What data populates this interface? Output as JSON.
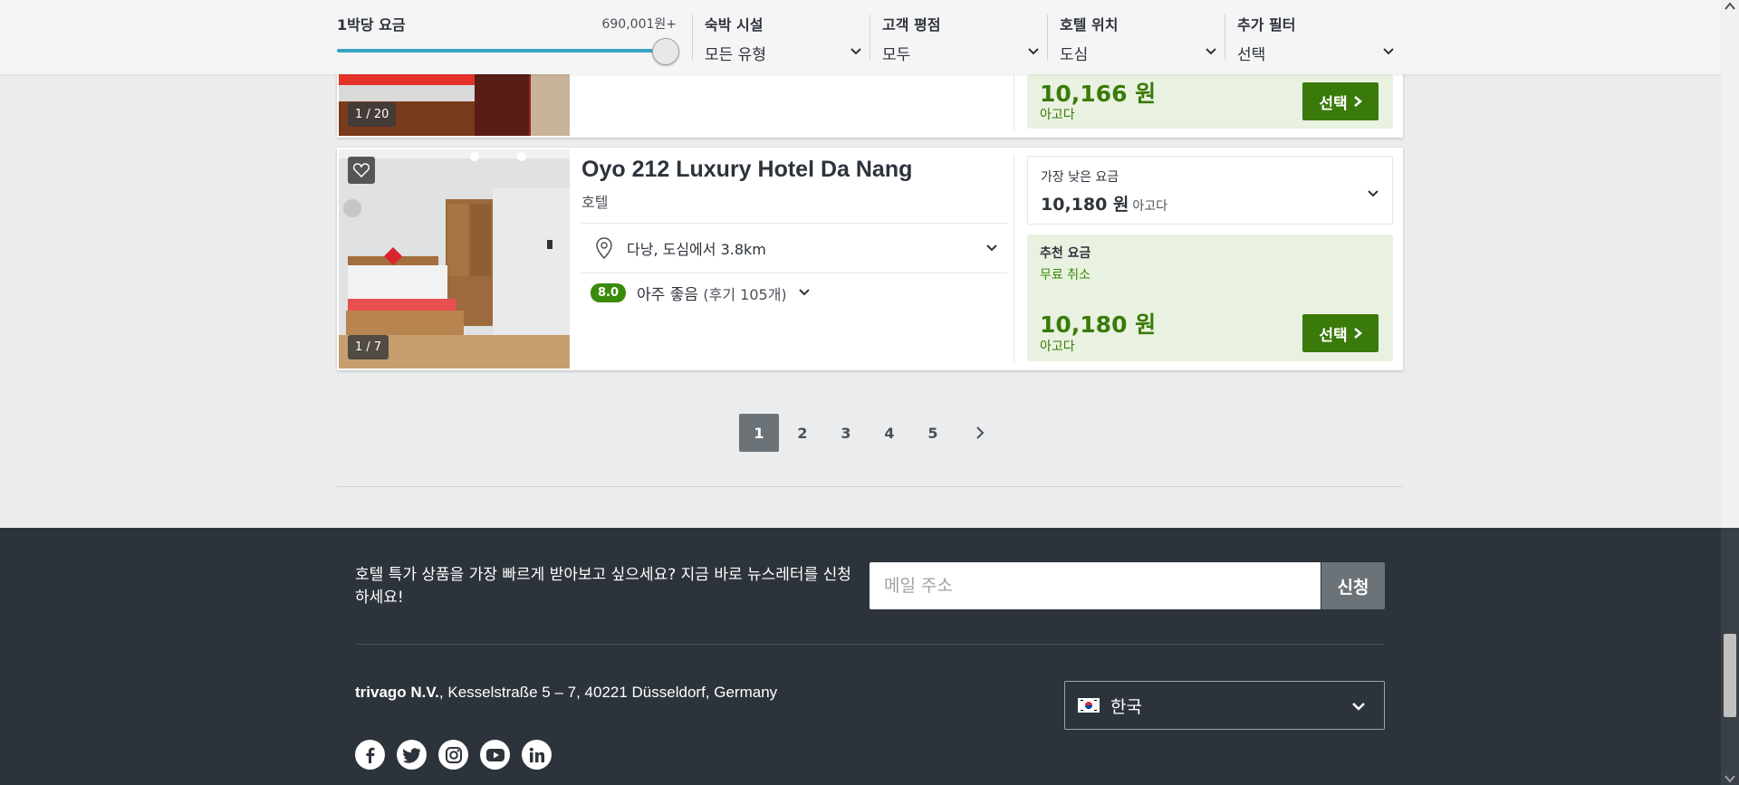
{
  "filters": {
    "price_label": "1박당 요금",
    "price_max": "690,001원+",
    "price_level": 1.0,
    "lodging_label": "숙박 시설",
    "lodging_value": "모든 유형",
    "rating_label": "고객 평점",
    "rating_value": "모두",
    "location_label": "호텔 위치",
    "location_value": "도심",
    "more_label": "추가 필터",
    "more_value": "선택"
  },
  "prev_card": {
    "photo_counter": "1 / 20",
    "price": "10,166 원",
    "source": "아고다",
    "select_label": "선택"
  },
  "hotel": {
    "name": "Oyo 212 Luxury Hotel Da Nang",
    "type": "호텔",
    "location": "다낭, 도심에서 3.8km",
    "rating_score": "8.0",
    "rating_text": "아주 좋음",
    "review_count": "(후기 105개)",
    "photo_counter": "1 / 7",
    "lowest_label": "가장 낮은 요금",
    "lowest_price": "10,180 원",
    "lowest_source": "아고다",
    "recommended_label": "추천 요금",
    "free_cancel": "무료 취소",
    "rec_price": "10,180 원",
    "rec_source": "아고다",
    "select_label": "선택"
  },
  "pagination": {
    "pages": [
      "1",
      "2",
      "3",
      "4",
      "5"
    ],
    "active": "1"
  },
  "footer": {
    "newsletter_text": "호텔 특가 상품을 가장 빠르게 받아보고 싶으세요? 지금 바로 뉴스레터를 신청하세요!",
    "email_placeholder": "메일 주소",
    "subscribe_label": "신청",
    "company_name": "trivago N.V.",
    "company_address": ", Kesselstraße 5 – 7, 40221 Düsseldorf, Germany",
    "language": "한국",
    "social": [
      "facebook-icon",
      "twitter-icon",
      "instagram-icon",
      "youtube-icon",
      "linkedin-icon"
    ]
  },
  "colors": {
    "accent_green": "#3a7a0a",
    "slider_blue": "#37a3c2",
    "footer_bg": "#2d333b"
  }
}
